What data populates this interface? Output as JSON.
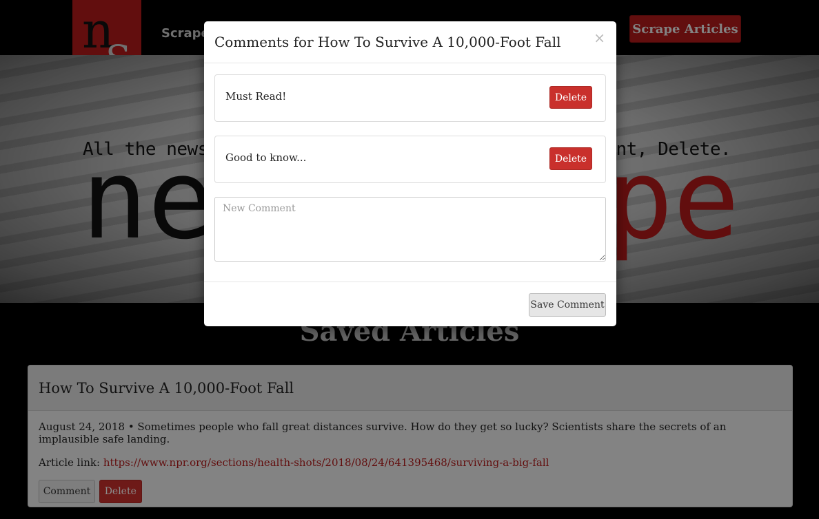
{
  "nav": {
    "logo_n": "n",
    "logo_s": "S",
    "logo_word_a": "new",
    "logo_word_b": "scrape",
    "link_scrape": "Scrape",
    "scrape_button": "Scrape Articles"
  },
  "hero": {
    "tagline_left": "All the news y",
    "tagline_right": "mment, Delete.",
    "big_left": "ne",
    "big_right": "pe"
  },
  "saved": {
    "title": "Saved Articles"
  },
  "article": {
    "headline": "How To Survive A 10,000-Foot Fall",
    "summary": "August 24, 2018 • Sometimes people who fall great distances survive. How do they get so lucky? Scientists share the secrets of an implausible safe landing.",
    "link_label": "Article link:",
    "link_url": "https://www.npr.org/sections/health-shots/2018/08/24/641395468/surviving-a-big-fall",
    "comment_button": "Comment",
    "delete_button": "Delete"
  },
  "modal": {
    "title": "Comments for How To Survive A 10,000-Foot Fall",
    "close": "×",
    "comments": [
      {
        "text": "Must Read!",
        "delete_label": "Delete"
      },
      {
        "text": "Good to know...",
        "delete_label": "Delete"
      }
    ],
    "new_comment_placeholder": "New Comment",
    "save_button": "Save Comment"
  },
  "colors": {
    "brand_red": "#b31b1b",
    "danger": "#c9302c"
  }
}
